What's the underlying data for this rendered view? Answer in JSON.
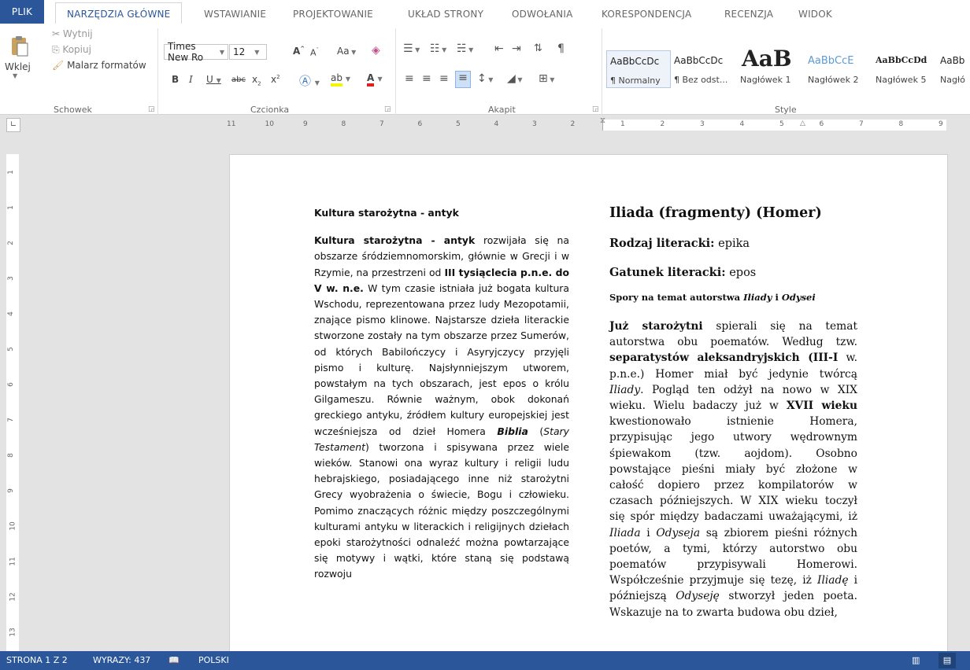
{
  "tabs": {
    "file": "PLIK",
    "items": [
      "NARZĘDZIA GŁÓWNE",
      "WSTAWIANIE",
      "PROJEKTOWANIE",
      "UKŁAD STRONY",
      "ODWOŁANIA",
      "KORESPONDENCJA",
      "RECENZJA",
      "WIDOK"
    ]
  },
  "ribbon": {
    "clipboard": {
      "paste": "Wklej",
      "cut": "Wytnij",
      "copy": "Kopiuj",
      "painter": "Malarz formatów",
      "label": "Schowek"
    },
    "font": {
      "name": "Times New Ro",
      "size": "12",
      "case": "Aa",
      "label": "Czcionka"
    },
    "paragraph": {
      "label": "Akapit"
    },
    "styles": {
      "label": "Style",
      "items": [
        {
          "sample": "AaBbCcDc",
          "name": "¶ Normalny"
        },
        {
          "sample": "AaBbCcDc",
          "name": "¶ Bez odst..."
        },
        {
          "sample": "AaB",
          "name": "Nagłówek 1"
        },
        {
          "sample": "AaBbCcE",
          "name": "Nagłówek 2"
        },
        {
          "sample": "AaBbCcDd",
          "name": "Nagłówek 5"
        },
        {
          "sample": "AaBb",
          "name": "Nagłó"
        }
      ]
    }
  },
  "ruler": {
    "left": [
      "11",
      "10",
      "9",
      "8",
      "7",
      "6",
      "5",
      "4",
      "3",
      "2"
    ],
    "right": [
      "1",
      "2",
      "3",
      "4",
      "5",
      "6",
      "7",
      "8",
      "9"
    ],
    "vertical": [
      "1",
      "1",
      "2",
      "3",
      "4",
      "5",
      "6",
      "7",
      "8",
      "9",
      "10",
      "11",
      "12",
      "13"
    ]
  },
  "document": {
    "left": {
      "title": "Kultura starożytna - antyk",
      "body": [
        {
          "t": "Kultura starożytna - antyk",
          "s": "b"
        },
        {
          "t": " rozwijała się na obszarze śródziemnomorskim, głównie w Grecji i w Rzymie, na przestrzeni od "
        },
        {
          "t": "III tysiąclecia p.n.e. do V w. n.e.",
          "s": "b"
        },
        {
          "t": " W tym czasie istniała już bogata kultura Wschodu, reprezentowana przez ludy Mezopotamii, znające pismo klinowe. Najstarsze dzieła literackie stworzone zostały na tym obszarze przez Sumerów, od których Babilończycy i Asyryjczycy przyjęli pismo i kulturę. Najsłynniejszym utworem, powstałym na tych obszarach, jest epos o królu Gilgameszu. Równie ważnym, obok dokonań greckiego antyku, źródłem kultury europejskiej jest wcześniejsza od dzieł Homera "
        },
        {
          "t": "Biblia",
          "s": "bi"
        },
        {
          "t": " ("
        },
        {
          "t": "Stary Testament",
          "s": "i"
        },
        {
          "t": ") tworzona i spisywana przez wiele wieków. Stanowi ona wyraz kultury i religii ludu hebrajskiego, posiadającego inne niż starożytni Grecy wyobrażenia o świecie, Bogu i człowieku. Pomimo znaczących różnic między poszczególnymi kulturami antyku w literackich i religijnych dziełach epoki starożytności odnaleźć można powtarzające się motywy i wątki, które staną się podstawą rozwoju"
        }
      ]
    },
    "right": {
      "title": "Iliada (fragmenty) (Homer)",
      "genre_label": "Rodzaj literacki:",
      "genre_value": " epika",
      "kind_label": "Gatunek literacki:",
      "kind_value": " epos",
      "subheading": [
        {
          "t": "Spory na temat autorstwa ",
          "s": "b"
        },
        {
          "t": "Iliady",
          "s": "bi"
        },
        {
          "t": " i ",
          "s": "b"
        },
        {
          "t": "Odysei",
          "s": "bi"
        }
      ],
      "body": [
        {
          "t": "Już starożytni",
          "s": "b"
        },
        {
          "t": " spierali się na temat autorstwa obu poematów. Według tzw. "
        },
        {
          "t": "separatystów aleksandryjskich (III-I",
          "s": "b"
        },
        {
          "t": " w. p.n.e.) Homer miał być jedynie twórcą "
        },
        {
          "t": "Iliady",
          "s": "i"
        },
        {
          "t": ". Pogląd ten odżył na nowo w XIX wieku. Wielu badaczy już w "
        },
        {
          "t": "XVII wieku",
          "s": "b"
        },
        {
          "t": " kwestionowało istnienie Homera, przypisując jego utwory wędrownym śpiewakom (tzw. aojdom). Osobno powstające pieśni miały być złożone w całość dopiero przez kompilatorów w czasach późniejszych. W XIX wieku toczył się spór między badaczami uważającymi, iż "
        },
        {
          "t": "Iliada",
          "s": "i"
        },
        {
          "t": " i "
        },
        {
          "t": "Odyseja",
          "s": "i"
        },
        {
          "t": " są zbiorem pieśni różnych poetów, a tymi, którzy autorstwo obu poematów przypisywali Homerowi. Współcześnie przyjmuje się tezę, iż "
        },
        {
          "t": "Iliadę",
          "s": "i"
        },
        {
          "t": " i późniejszą "
        },
        {
          "t": "Odyseję",
          "s": "i"
        },
        {
          "t": " stworzył jeden poeta. Wskazuje na to zwarta budowa obu dzieł,"
        }
      ]
    }
  },
  "status": {
    "page": "STRONA 1 Z 2",
    "words": "WYRAZY: 437",
    "language": "POLSKI"
  },
  "colors": {
    "accent": "#2b579a",
    "ribbon_bg": "#ffffff",
    "workspace": "#e3e3e3"
  }
}
